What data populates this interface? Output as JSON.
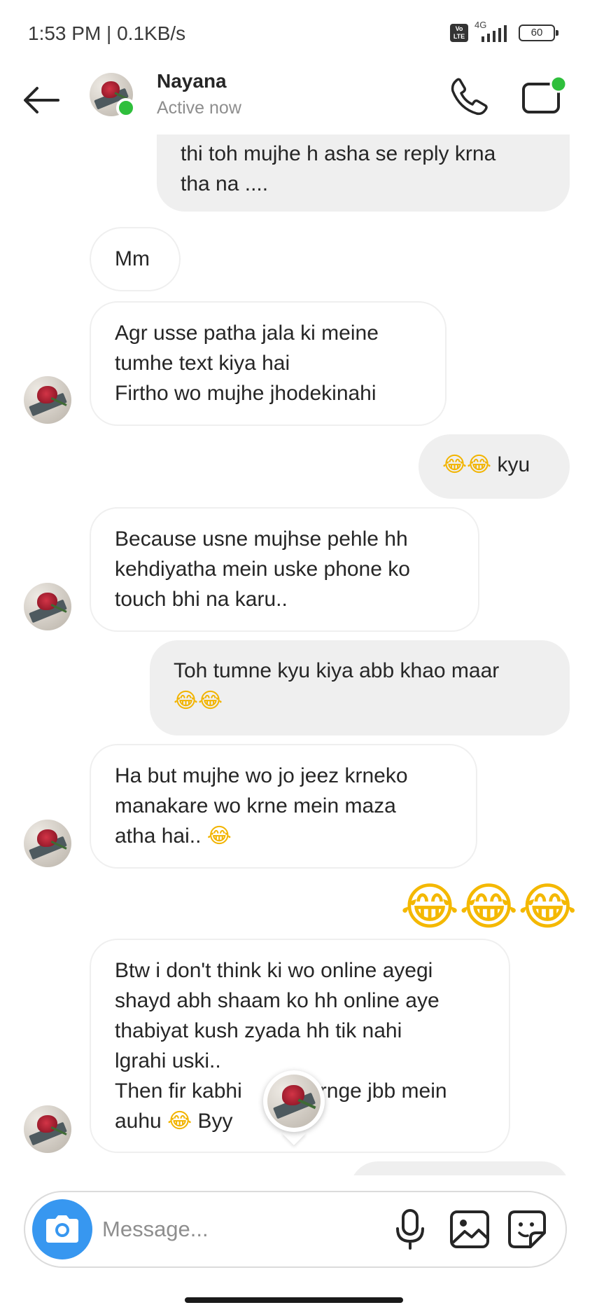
{
  "status_bar": {
    "time_speed": "1:53 PM | 0.1KB/s",
    "volte": "Vo LTE",
    "network": "4G",
    "battery": "60"
  },
  "header": {
    "contact_name": "Nayana",
    "contact_status": "Active now"
  },
  "messages": [
    {
      "direction": "outgoing",
      "lines": [
        "thi toh mujhe h asha se reply krna",
        "tha na ...."
      ]
    },
    {
      "direction": "incoming",
      "lines": [
        "Mm"
      ]
    },
    {
      "direction": "incoming",
      "lines": [
        "Agr usse patha jala ki meine",
        "tumhe text kiya hai",
        "Firtho wo mujhe jhodekinahi"
      ]
    },
    {
      "direction": "outgoing",
      "text": "kyu",
      "emoji": "😂😂"
    },
    {
      "direction": "incoming",
      "lines": [
        "Because usne mujhse pehle hh",
        "kehdiyatha mein uske phone ko",
        "touch bhi na karu.."
      ]
    },
    {
      "direction": "outgoing",
      "lines": [
        "Toh tumne kyu kiya abb khao maar"
      ],
      "emoji": "😂😂"
    },
    {
      "direction": "incoming",
      "lines": [
        "Ha but mujhe wo jo jeez krneko",
        "manakare wo krne mein maza",
        "atha hai.."
      ],
      "emoji": "😂"
    },
    {
      "direction": "outgoing",
      "emoji": "😂😂😂"
    },
    {
      "direction": "incoming",
      "lines": [
        "Btw i don't think ki wo online ayegi",
        "shayd abh shaam ko hh online aye",
        "thabiyat kush zyada hh tik nahi",
        "lgrahi uski..",
        "Then fir kabhi",
        "krnge jbb mein",
        "auhu",
        "Byy"
      ],
      "emoji": "😂"
    }
  ],
  "composer": {
    "placeholder": "Message..."
  },
  "icons": {
    "back": "arrow-left",
    "call": "phone",
    "video": "video-camera",
    "camera": "camera",
    "mic": "microphone",
    "gallery": "image",
    "sticker": "sticker"
  },
  "colors": {
    "online_green": "#2fbf3c",
    "camera_blue": "#3797f0",
    "outgoing_bubble": "#efefef"
  }
}
